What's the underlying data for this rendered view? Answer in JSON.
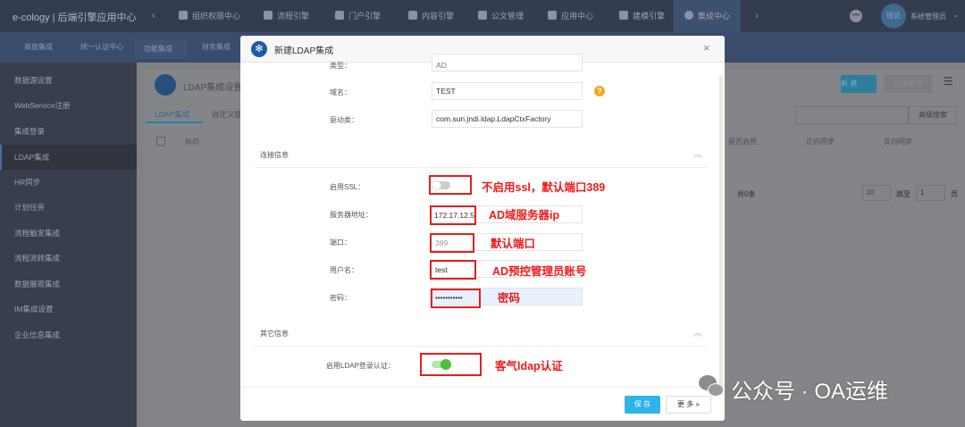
{
  "app_title": "e-cology | 后端引擎应用中心",
  "top_nav": [
    {
      "label": "组织权限中心"
    },
    {
      "label": "流程引擎"
    },
    {
      "label": "门户引擎"
    },
    {
      "label": "内容引擎"
    },
    {
      "label": "公文管理"
    },
    {
      "label": "应用中心"
    },
    {
      "label": "建模引擎"
    },
    {
      "label": "集成中心",
      "active": true
    }
  ],
  "user": {
    "avatar": "理员",
    "name": "系统管理员"
  },
  "sub_nav": [
    {
      "label": "商旅集成"
    },
    {
      "label": "统一认证中心"
    },
    {
      "label": "功能集成",
      "active": true
    },
    {
      "label": "财务集成"
    }
  ],
  "sidebar": {
    "items": [
      {
        "label": "数据源设置"
      },
      {
        "label": "WebService注册"
      },
      {
        "label": "集成登录"
      },
      {
        "label": "LDAP集成",
        "active": true
      },
      {
        "label": "HR同步"
      },
      {
        "label": "计划任务"
      },
      {
        "label": "流程触发集成"
      },
      {
        "label": "流程流转集成"
      },
      {
        "label": "数据展现集成"
      },
      {
        "label": "IM集成设置"
      },
      {
        "label": "企业信息集成"
      }
    ]
  },
  "page": {
    "title": "LDAP集成设置",
    "tabs": [
      "LDAP集成",
      "自定义接"
    ],
    "new_btn": "新 建",
    "batch_delete_btn": "批量删除",
    "advanced_search": "高级搜索",
    "columns": [
      "标识",
      "是否启用",
      "正向同步",
      "反向同步"
    ],
    "total": "共0条",
    "page_size": "10",
    "goto": "跳至",
    "page_num": "1",
    "page_unit": "页"
  },
  "modal": {
    "title": "新建LDAP集成",
    "fields_top": [
      {
        "label": "类型：",
        "value": "AD"
      },
      {
        "label": "域名：",
        "value": "TEST"
      },
      {
        "label": "驱动类：",
        "value": "com.sun.jndi.ldap.LdapCtxFactory"
      }
    ],
    "section_connection": "连接信息",
    "ssl": {
      "label": "启用SSL：",
      "enabled": false
    },
    "server": {
      "label": "服务器地址：",
      "value": "172.17.12.5"
    },
    "port": {
      "label": "端口：",
      "placeholder": "389"
    },
    "username": {
      "label": "用户名：",
      "value": "test"
    },
    "password": {
      "label": "密码：",
      "value": "•••••••••••"
    },
    "section_other": "其它信息",
    "ldap_login": {
      "label": "启用LDAP登录认证：",
      "enabled": true
    },
    "save": "保 存",
    "more": "更 多"
  },
  "annotations": {
    "ssl": "不启用ssl，默认端口389",
    "server": "AD域服务器ip",
    "port": "默认端口",
    "username": "AD预控管理员账号",
    "password": "密码",
    "ldap": "客气ldap认证"
  },
  "watermark": "公众号 · OA运维",
  "colors": {
    "accent": "#2fb3ea",
    "annotation": "#e02020",
    "toggle_on": "#4cbf3f",
    "help": "#f5a623"
  }
}
